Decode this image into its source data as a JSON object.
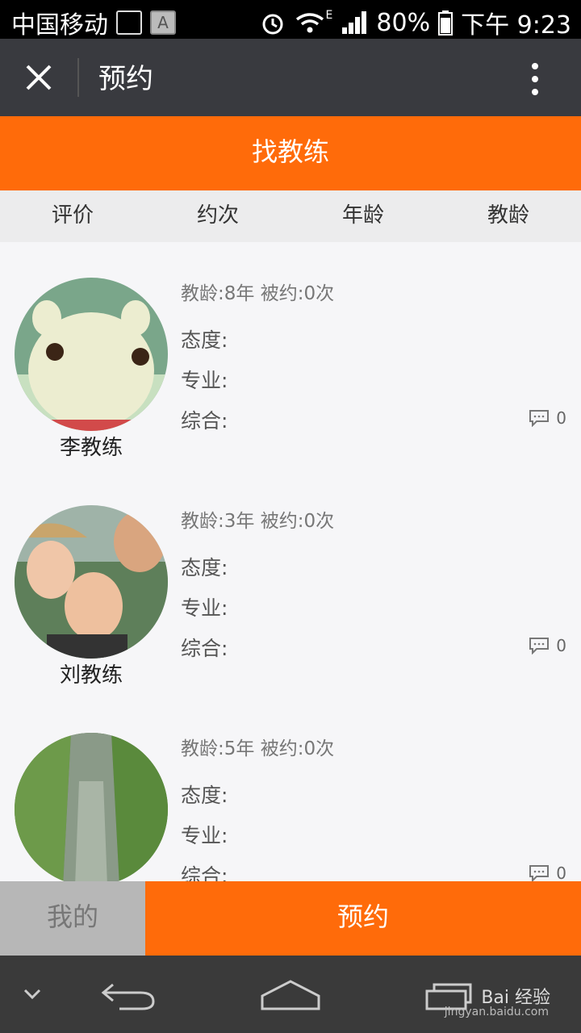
{
  "status_bar": {
    "carrier": "中国移动",
    "network": "E",
    "battery": "80%",
    "time": "下午 9:23",
    "app_icon_letter": "A"
  },
  "app_bar": {
    "title": "预约"
  },
  "banner": {
    "label": "找教练"
  },
  "sort_tabs": [
    "评价",
    "约次",
    "年龄",
    "教龄"
  ],
  "coaches": [
    {
      "name": "李教练",
      "summary": "教龄:8年 被约:0次",
      "attitude_label": "态度:",
      "professional_label": "专业:",
      "overall_label": "综合:",
      "comments": "0"
    },
    {
      "name": "刘教练",
      "summary": "教龄:3年 被约:0次",
      "attitude_label": "态度:",
      "professional_label": "专业:",
      "overall_label": "综合:",
      "comments": "0"
    },
    {
      "name": "",
      "summary": "教龄:5年 被约:0次",
      "attitude_label": "态度:",
      "professional_label": "专业:",
      "overall_label": "综合:",
      "comments": "0"
    }
  ],
  "bottom_bar": {
    "mine_label": "我的",
    "book_label": "预约"
  },
  "watermark": {
    "brand": "Bai 经验",
    "url": "jingyan.baidu.com"
  },
  "colors": {
    "accent": "#ff6b0a",
    "app_bar": "#393a3f"
  }
}
